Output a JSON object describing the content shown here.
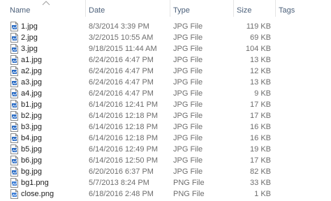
{
  "columns": {
    "name": "Name",
    "date": "Date",
    "type": "Type",
    "size": "Size",
    "tags": "Tags"
  },
  "files": [
    {
      "name": "1.jpg",
      "date": "8/3/2014 3:39 PM",
      "type": "JPG File",
      "size": "119 KB",
      "icon": "jpg-file-icon"
    },
    {
      "name": "2.jpg",
      "date": "3/2/2015 10:55 AM",
      "type": "JPG File",
      "size": "69 KB",
      "icon": "jpg-file-icon"
    },
    {
      "name": "3.jpg",
      "date": "9/18/2015 11:44 AM",
      "type": "JPG File",
      "size": "104 KB",
      "icon": "jpg-file-icon"
    },
    {
      "name": "a1.jpg",
      "date": "6/24/2016 4:47 PM",
      "type": "JPG File",
      "size": "13 KB",
      "icon": "jpg-file-icon"
    },
    {
      "name": "a2.jpg",
      "date": "6/24/2016 4:47 PM",
      "type": "JPG File",
      "size": "12 KB",
      "icon": "jpg-file-icon"
    },
    {
      "name": "a3.jpg",
      "date": "6/24/2016 4:47 PM",
      "type": "JPG File",
      "size": "13 KB",
      "icon": "jpg-file-icon"
    },
    {
      "name": "a4.jpg",
      "date": "6/24/2016 4:47 PM",
      "type": "JPG File",
      "size": "9 KB",
      "icon": "jpg-file-icon"
    },
    {
      "name": "b1.jpg",
      "date": "6/14/2016 12:41 PM",
      "type": "JPG File",
      "size": "17 KB",
      "icon": "jpg-file-icon"
    },
    {
      "name": "b2.jpg",
      "date": "6/14/2016 12:18 PM",
      "type": "JPG File",
      "size": "17 KB",
      "icon": "jpg-file-icon"
    },
    {
      "name": "b3.jpg",
      "date": "6/14/2016 12:18 PM",
      "type": "JPG File",
      "size": "16 KB",
      "icon": "jpg-file-icon"
    },
    {
      "name": "b4.jpg",
      "date": "6/14/2016 12:18 PM",
      "type": "JPG File",
      "size": "16 KB",
      "icon": "jpg-file-icon"
    },
    {
      "name": "b5.jpg",
      "date": "6/14/2016 12:49 PM",
      "type": "JPG File",
      "size": "19 KB",
      "icon": "jpg-file-icon"
    },
    {
      "name": "b6.jpg",
      "date": "6/14/2016 12:50 PM",
      "type": "JPG File",
      "size": "17 KB",
      "icon": "jpg-file-icon"
    },
    {
      "name": "bg.jpg",
      "date": "6/20/2016 6:37 PM",
      "type": "JPG File",
      "size": "82 KB",
      "icon": "jpg-file-icon"
    },
    {
      "name": "bg1.png",
      "date": "5/7/2013 8:24 PM",
      "type": "PNG File",
      "size": "33 KB",
      "icon": "png-file-icon"
    },
    {
      "name": "close.png",
      "date": "6/18/2016 2:48 PM",
      "type": "PNG File",
      "size": "1 KB",
      "icon": "png-file-icon"
    }
  ],
  "colors": {
    "header_text": "#4c607a",
    "icon_accent": "#2b6cc4"
  }
}
